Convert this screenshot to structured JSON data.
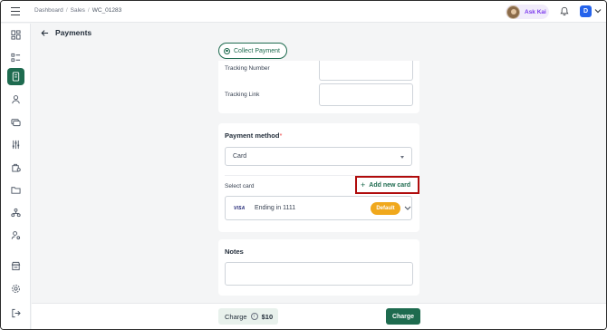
{
  "breadcrumb": {
    "items": [
      "Dashboard",
      "Sales",
      "WC_01283"
    ],
    "separator": "/"
  },
  "header": {
    "ask_kai_label": "Ask Kai",
    "user_initial": "D"
  },
  "sidebar": {
    "active_index": 2,
    "icons": [
      "dashboard-icon",
      "list-icon",
      "invoice-icon",
      "user-icon",
      "payments-icon",
      "sliders-icon",
      "bag-icon",
      "folder-icon",
      "network-icon",
      "user-settings-icon",
      "store-icon",
      "settings-icon",
      "logout-icon"
    ]
  },
  "page": {
    "title": "Payments",
    "collect_payment_label": "Collect Payment"
  },
  "tracking": {
    "tracking_number_label": "Tracking Number",
    "tracking_number_value": "",
    "tracking_link_label": "Tracking Link",
    "tracking_link_value": ""
  },
  "payment": {
    "method_title": "Payment method",
    "required_mark": "*",
    "method_value": "Card",
    "select_card_label": "Select card",
    "add_new_card_label": "Add new card",
    "add_icon_glyph": "+",
    "card_brand": "VISA",
    "card_ending": "Ending in 1111",
    "default_badge": "Default"
  },
  "notes": {
    "title": "Notes",
    "value": ""
  },
  "footer": {
    "charge_label": "Charge",
    "info_glyph": "i",
    "charge_amount": "$10",
    "charge_button_label": "Charge"
  },
  "colors": {
    "primary": "#1e6b4f",
    "highlight_border": "#b00c0c",
    "default_badge": "#f0a81c",
    "user_badge": "#2563eb",
    "ask_kai_text": "#7c3aed"
  }
}
